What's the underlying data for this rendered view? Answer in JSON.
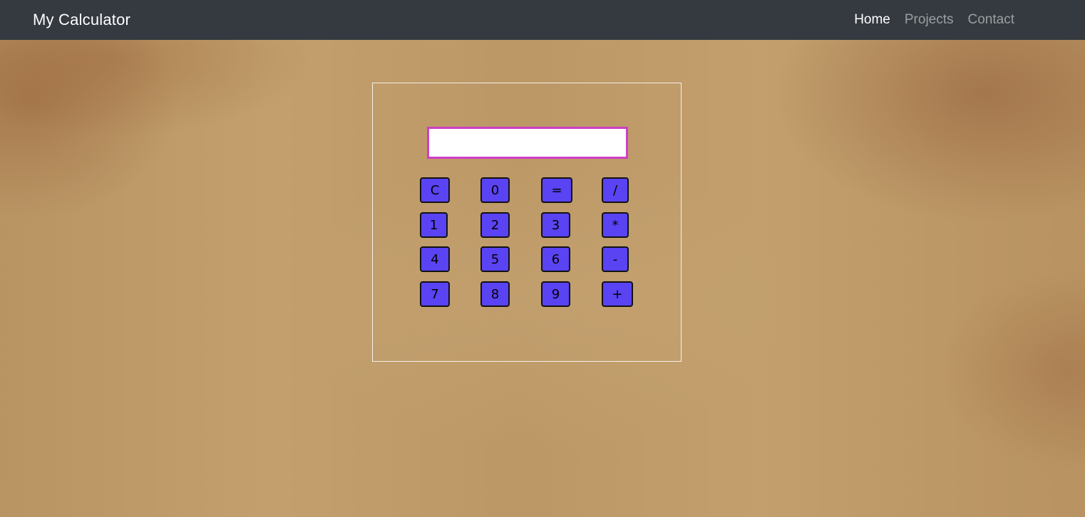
{
  "navbar": {
    "brand": "My Calculator",
    "links": [
      "Home",
      "Projects",
      "Contact"
    ],
    "active": "Home"
  },
  "calculator": {
    "display_value": "",
    "keys": [
      "C",
      "0",
      "=",
      "/",
      "1",
      "2",
      "3",
      "*",
      "4",
      "5",
      "6",
      "-",
      "7",
      "8",
      "9",
      "+"
    ]
  },
  "colors": {
    "navbar_bg": "#343a40",
    "key_bg": "#5a43f3",
    "display_border": "#cf3fc4"
  }
}
